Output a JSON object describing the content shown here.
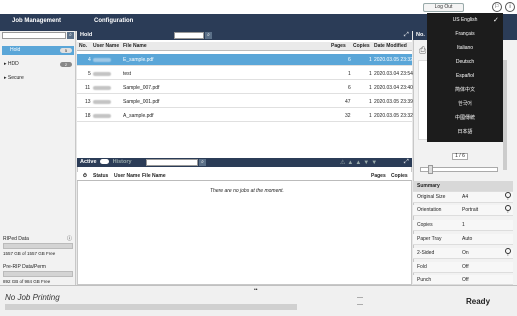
{
  "topbar": {
    "logout_label": "Log Out"
  },
  "nav": {
    "tabs": [
      {
        "label": "Job Management"
      },
      {
        "label": "Configuration"
      }
    ]
  },
  "languages": [
    "US English",
    "Français",
    "Italiano",
    "Deutsch",
    "Español",
    "简体中文",
    "한국어",
    "中國傳統",
    "日本語"
  ],
  "selected_language": "US English",
  "left": {
    "tree": [
      {
        "label": "Hold",
        "count": "5"
      },
      {
        "label": "HDD",
        "count": "2"
      },
      {
        "label": "Secure",
        "count": ""
      }
    ],
    "ripped_label": "RIPed Data",
    "ripped_text": "1557 GB of 1557 GB Free",
    "prerip_label": "Pre-RIP Data/Perm",
    "prerip_text": "892 GB of 984 GB Free"
  },
  "hold": {
    "title": "Hold",
    "columns": {
      "no": "No.",
      "user": "User Name",
      "file": "File Name",
      "pages": "Pages",
      "copies": "Copies",
      "date": "Date Modified"
    },
    "rows": [
      {
        "no": "4",
        "file": "E_sample.pdf",
        "pages": "6",
        "copies": "1",
        "date": "2020.03.05 23:32"
      },
      {
        "no": "5",
        "file": "test",
        "pages": "1",
        "copies": "1",
        "date": "2020.03.04 23:54"
      },
      {
        "no": "11",
        "file": "Sample_007.pdf",
        "pages": "6",
        "copies": "1",
        "date": "2020.03.04 23:40"
      },
      {
        "no": "13",
        "file": "Sample_001.pdf",
        "pages": "47",
        "copies": "1",
        "date": "2020.03.05 23:39"
      },
      {
        "no": "18",
        "file": "A_sample.pdf",
        "pages": "32",
        "copies": "1",
        "date": "2020.03.05 23:32"
      }
    ]
  },
  "active": {
    "active_label": "Active",
    "history_label": "History",
    "columns": {
      "status": "Status",
      "user": "User Name",
      "file": "File Name",
      "pages": "Pages",
      "copies": "Copies"
    },
    "empty_text": "There are no jobs at the moment."
  },
  "right": {
    "title": "No.",
    "page_indicator": "1 / 6",
    "summary_title": "Summary",
    "summary": [
      {
        "label": "Original Size",
        "value": "A4"
      },
      {
        "label": "Orientation",
        "value": "Portrait"
      },
      {
        "label": "Copies",
        "value": "1"
      },
      {
        "label": "Paper Tray",
        "value": "Auto"
      },
      {
        "label": "2-Sided",
        "value": "On"
      },
      {
        "label": "Fold",
        "value": "Off"
      },
      {
        "label": "Punch",
        "value": "Off"
      }
    ]
  },
  "bottom": {
    "status_text": "No Job Printing",
    "ready_label": "Ready"
  }
}
